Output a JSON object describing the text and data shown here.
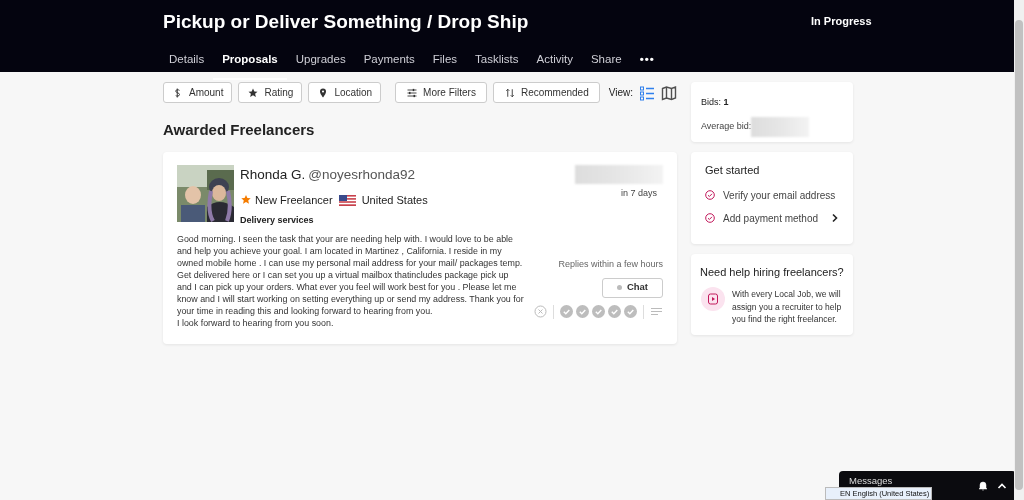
{
  "header": {
    "title": "Pickup or Deliver Something / Drop Ship",
    "status": "In Progress"
  },
  "tabs": [
    {
      "label": "Details",
      "selected": false
    },
    {
      "label": "Proposals",
      "selected": true
    },
    {
      "label": "Upgrades",
      "selected": false
    },
    {
      "label": "Payments",
      "selected": false
    },
    {
      "label": "Files",
      "selected": false
    },
    {
      "label": "Tasklists",
      "selected": false
    },
    {
      "label": "Activity",
      "selected": false
    },
    {
      "label": "Share",
      "selected": false
    },
    {
      "label": "•••",
      "selected": false
    }
  ],
  "filters": [
    {
      "label": "Amount"
    },
    {
      "label": "Rating"
    },
    {
      "label": "Location"
    }
  ],
  "sort_buttons": [
    {
      "label": "More Filters"
    },
    {
      "label": "Recommended"
    }
  ],
  "view": {
    "label": "View:",
    "options": [
      {
        "kind": "list",
        "selected": true
      },
      {
        "kind": "map",
        "selected": false
      }
    ]
  },
  "section_title": "Awarded Freelancers",
  "proposal": {
    "name": "Rhonda G.",
    "username": "@noyesrhonda92",
    "badge": "New Freelancer",
    "country": "United States",
    "skill": "Delivery services",
    "delivery": "in 7 days",
    "replies": "Replies within a few hours",
    "chat": "Chat",
    "paragraphs": [
      "Good morning. I seen the task that your are needing help with. I would love to be able and help you achieve your goal. I am located in Martinez , California. I reside in my owned mobile home . I can use my personal mail address for your mail/ packages temp. Get delivered here or I can set you up a virtual mailbox thatincludes package pick up and I can pick up your orders. What ever you feel will work best for you . Please let me know and I will start working on setting everything up or send my address. Thank you for your time in reading this and looking forward to hearing from you.",
      "I look forward to hearing from you soon."
    ]
  },
  "bids": {
    "label": "Bids:",
    "count": "1",
    "average_label": "Average bid:"
  },
  "get_started": {
    "title": "Get started",
    "items": [
      {
        "label": "Verify your email address",
        "arrow": false
      },
      {
        "label": "Add payment method",
        "arrow": true
      }
    ]
  },
  "help": {
    "title": "Need help hiring freelancers?",
    "text": "With every Local Job, we will assign you a recruiter to help you find the right freelancer."
  },
  "messages": {
    "title": "Messages"
  },
  "language": {
    "value": "EN English (United States)"
  }
}
